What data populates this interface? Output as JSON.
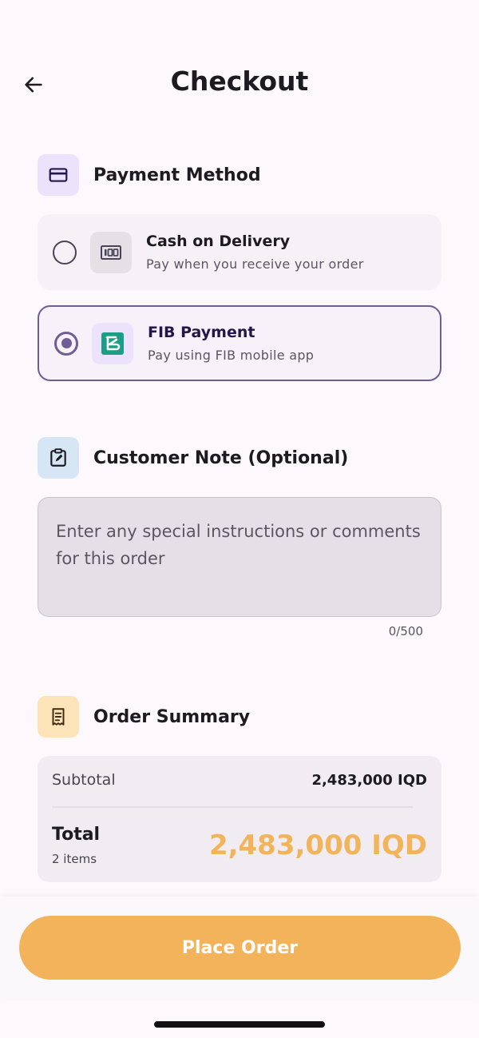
{
  "header": {
    "title": "Checkout"
  },
  "payment": {
    "section_title": "Payment Method",
    "options": [
      {
        "title": "Cash on Delivery",
        "subtitle": "Pay when you receive your order",
        "icon": "cash-icon",
        "selected": false
      },
      {
        "title": "FIB Payment",
        "subtitle": "Pay using FIB mobile app",
        "icon": "fib-logo-icon",
        "selected": true
      }
    ]
  },
  "note": {
    "section_title": "Customer Note (Optional)",
    "placeholder": "Enter any special instructions or comments for this order",
    "value": "",
    "counter": "0/500"
  },
  "summary": {
    "section_title": "Order Summary",
    "subtotal_label": "Subtotal",
    "subtotal_value": "2,483,000 IQD",
    "total_label": "Total",
    "items_count": "2 items",
    "total_value": "2,483,000 IQD"
  },
  "actions": {
    "place_order": "Place Order"
  },
  "colors": {
    "accent": "#f2b35a",
    "primary": "#6f5d96",
    "background": "#fdf8fc"
  }
}
